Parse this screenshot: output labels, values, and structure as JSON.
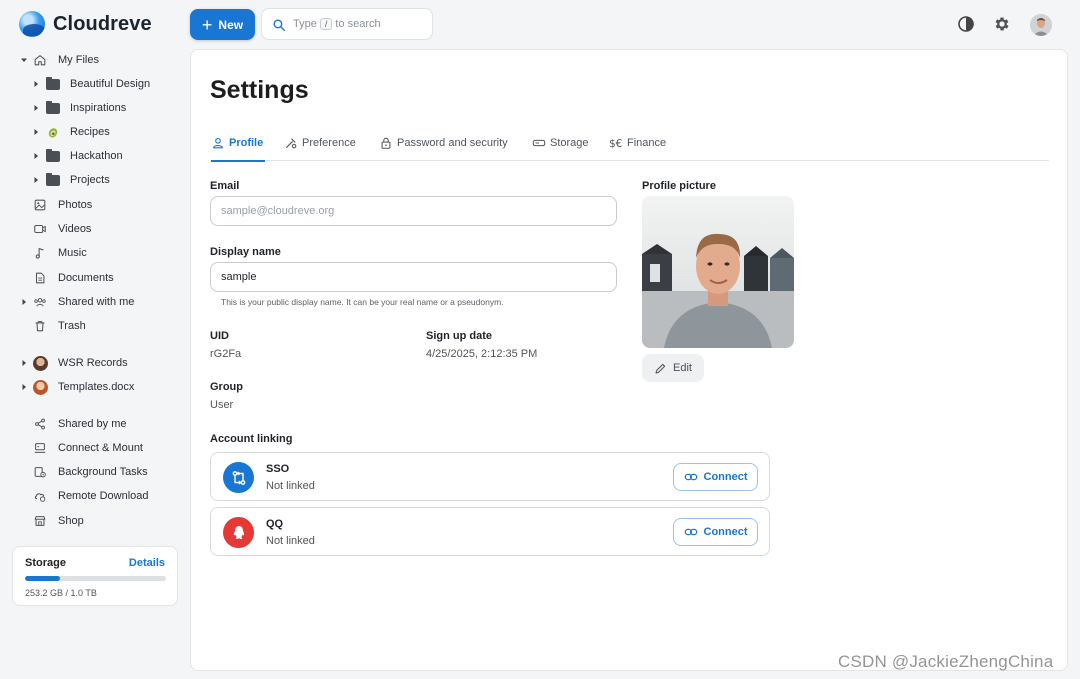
{
  "app": {
    "name": "Cloudreve"
  },
  "toolbar": {
    "new_label": "New",
    "search": {
      "prefix": "Type",
      "key": "/",
      "suffix": "to search"
    }
  },
  "sidebar": {
    "items": [
      {
        "label": "My Files",
        "icon": "home-icon"
      },
      {
        "label": "Beautiful Design",
        "icon": "folder-shared-icon"
      },
      {
        "label": "Inspirations",
        "icon": "folder-avatar-icon"
      },
      {
        "label": "Recipes",
        "icon": "avocado-icon"
      },
      {
        "label": "Hackathon",
        "icon": "folder-icon"
      },
      {
        "label": "Projects",
        "icon": "folder-icon"
      },
      {
        "label": "Photos",
        "icon": "image-icon"
      },
      {
        "label": "Videos",
        "icon": "video-icon"
      },
      {
        "label": "Music",
        "icon": "music-icon"
      },
      {
        "label": "Documents",
        "icon": "document-icon"
      },
      {
        "label": "Shared with me",
        "icon": "people-icon"
      },
      {
        "label": "Trash",
        "icon": "trash-icon"
      },
      {
        "label": "WSR Records",
        "icon": "avatar-icon"
      },
      {
        "label": "Templates.docx",
        "icon": "avatar-icon"
      },
      {
        "label": "Shared by me",
        "icon": "share-icon"
      },
      {
        "label": "Connect & Mount",
        "icon": "connect-icon"
      },
      {
        "label": "Background Tasks",
        "icon": "tasks-icon"
      },
      {
        "label": "Remote Download",
        "icon": "cloud-download-icon"
      },
      {
        "label": "Shop",
        "icon": "shop-icon"
      }
    ],
    "storage": {
      "title": "Storage",
      "details_label": "Details",
      "usage": "253.2 GB / 1.0 TB",
      "used_fraction": 0.247
    }
  },
  "settings": {
    "title": "Settings",
    "tabs": [
      "Profile",
      "Preference",
      "Password and security",
      "Storage",
      "Finance"
    ],
    "active_tab": "Profile",
    "email": {
      "label": "Email",
      "placeholder": "sample@cloudreve.org",
      "value": ""
    },
    "display_name": {
      "label": "Display name",
      "value": "sample",
      "helper": "This is your public display name. It can be your real name or a pseudonym."
    },
    "uid": {
      "label": "UID",
      "value": "rG2Fa"
    },
    "signup": {
      "label": "Sign up date",
      "value": "4/25/2025, 2:12:35 PM"
    },
    "group": {
      "label": "Group",
      "value": "User"
    },
    "profile_picture": {
      "label": "Profile picture",
      "edit_label": "Edit"
    },
    "account_linking": {
      "label": "Account linking",
      "accounts": [
        {
          "name": "SSO",
          "status": "Not linked",
          "action": "Connect",
          "color": "#1976d2"
        },
        {
          "name": "QQ",
          "status": "Not linked",
          "action": "Connect",
          "color": "#e53935"
        }
      ]
    }
  },
  "watermark": "CSDN @JackieZhengChina",
  "colors": {
    "accent": "#1976d2",
    "qq": "#e53935"
  }
}
